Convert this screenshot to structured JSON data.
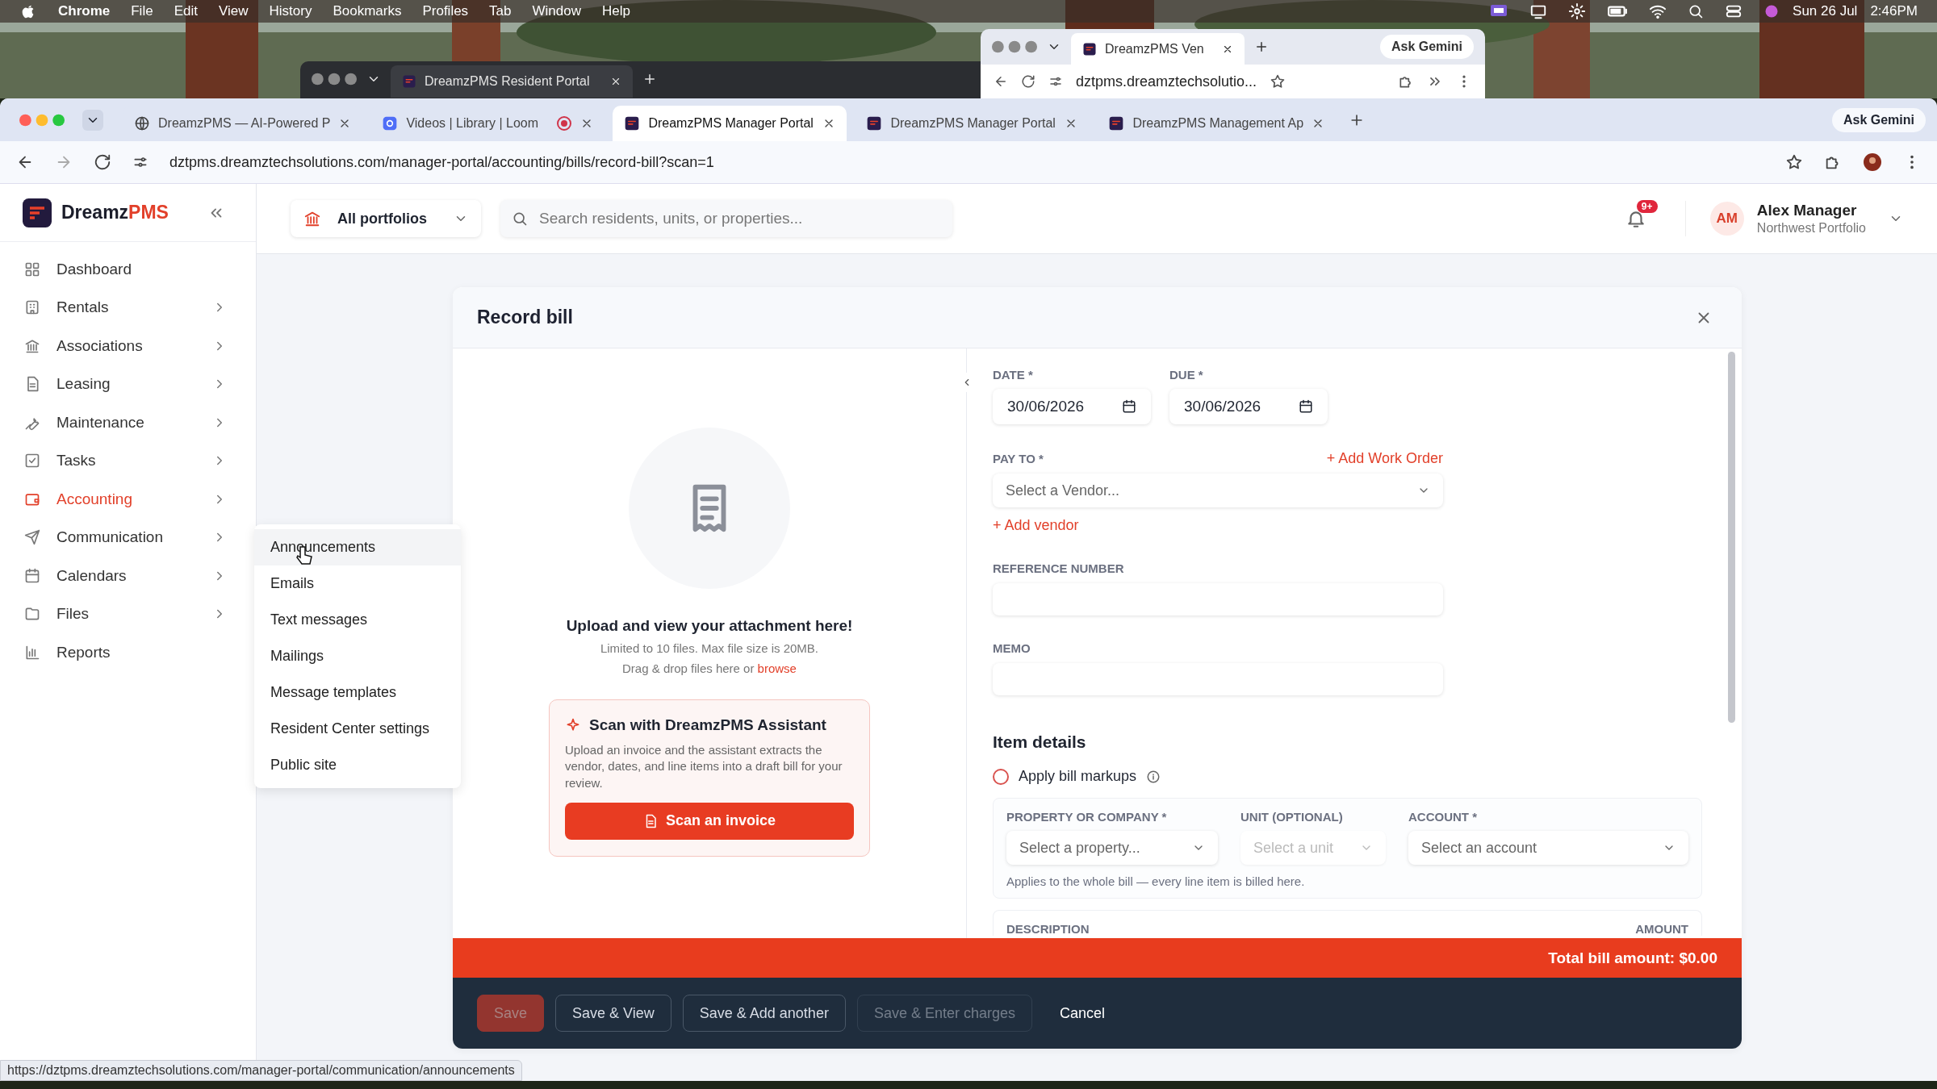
{
  "menubar": {
    "app": "Chrome",
    "menus": [
      "File",
      "Edit",
      "View",
      "History",
      "Bookmarks",
      "Profiles",
      "Tab",
      "Window",
      "Help"
    ],
    "date": "Sun 26 Jul",
    "time": "2:46PM"
  },
  "back_windows": [
    {
      "kind": "dark",
      "tab": "DreamzPMS Resident Portal"
    },
    {
      "kind": "light",
      "tab": "DreamzPMS Ven",
      "ask": "Ask Gemini",
      "url": "dztpms.dreamztechsolutio..."
    }
  ],
  "browser": {
    "tabs": [
      {
        "title": "DreamzPMS — AI-Powered P",
        "recording": false,
        "selected": false
      },
      {
        "title": "Videos | Library | Loom",
        "recording": true,
        "selected": false
      },
      {
        "title": "DreamzPMS Manager Portal",
        "recording": false,
        "selected": true
      },
      {
        "title": "DreamzPMS Manager Portal",
        "recording": false,
        "selected": false
      },
      {
        "title": "DreamzPMS Management Ap",
        "recording": false,
        "selected": false
      }
    ],
    "ask": "Ask Gemini",
    "url": "dztpms.dreamztechsolutions.com/manager-portal/accounting/bills/record-bill?scan=1"
  },
  "sidebar": {
    "brand": {
      "name": "Dreamz",
      "accent": "PMS"
    },
    "items": [
      {
        "label": "Dashboard",
        "expandable": false,
        "selected": false
      },
      {
        "label": "Rentals",
        "expandable": true,
        "selected": false
      },
      {
        "label": "Associations",
        "expandable": true,
        "selected": false
      },
      {
        "label": "Leasing",
        "expandable": true,
        "selected": false
      },
      {
        "label": "Maintenance",
        "expandable": true,
        "selected": false
      },
      {
        "label": "Tasks",
        "expandable": true,
        "selected": false
      },
      {
        "label": "Accounting",
        "expandable": true,
        "selected": true
      },
      {
        "label": "Communication",
        "expandable": true,
        "selected": false
      },
      {
        "label": "Calendars",
        "expandable": true,
        "selected": false
      },
      {
        "label": "Files",
        "expandable": true,
        "selected": false
      },
      {
        "label": "Reports",
        "expandable": false,
        "selected": false
      }
    ]
  },
  "header": {
    "portfolio": "All portfolios",
    "search": {
      "placeholder": "Search residents, units, or properties..."
    },
    "badge": "9+",
    "user": {
      "initials": "AM",
      "name": "Alex Manager",
      "subtitle": "Northwest Portfolio"
    }
  },
  "submenu": {
    "items": [
      {
        "label": "Announcements",
        "hovered": true
      },
      {
        "label": "Emails",
        "hovered": false
      },
      {
        "label": "Text messages",
        "hovered": false
      },
      {
        "label": "Mailings",
        "hovered": false
      },
      {
        "label": "Message templates",
        "hovered": false
      },
      {
        "label": "Resident Center settings",
        "hovered": false
      },
      {
        "label": "Public site",
        "hovered": false
      }
    ]
  },
  "modal": {
    "title": "Record bill",
    "upload": {
      "title": "Upload and view your attachment here!",
      "limits": "Limited to 10 files. Max file size is 20MB.",
      "drop_prompt": "Drag & drop files here or",
      "browse": "browse"
    },
    "scan": {
      "title": "Scan with DreamzPMS Assistant",
      "text": "Upload an invoice and the assistant extracts the vendor, dates, and line items into a draft bill for your review.",
      "button": "Scan an invoice"
    },
    "form": {
      "date": {
        "label": "DATE *",
        "value": "30/06/2026"
      },
      "due": {
        "label": "DUE *",
        "value": "30/06/2026"
      },
      "pay_to": {
        "label": "PAY TO *",
        "link": "+ Add Work Order",
        "placeholder": "Select a Vendor...",
        "add_link": "+ Add vendor"
      },
      "reference": {
        "label": "REFERENCE NUMBER"
      },
      "memo": {
        "label": "MEMO"
      },
      "item_details": {
        "heading": "Item details",
        "markups": {
          "label": "Apply bill markups",
          "checked": false
        },
        "fields": [
          {
            "label": "PROPERTY OR COMPANY *",
            "placeholder": "Select a property...",
            "disabled": false
          },
          {
            "label": "UNIT (OPTIONAL)",
            "placeholder": "Select a unit",
            "disabled": true
          },
          {
            "label": "ACCOUNT *",
            "placeholder": "Select an account",
            "disabled": false
          }
        ],
        "hint": "Applies to the whole bill — every line item is billed here.",
        "columns": [
          "DESCRIPTION",
          "AMOUNT"
        ]
      }
    },
    "total": "Total bill amount: $0.00",
    "buttons": [
      {
        "label": "Save",
        "kind": "primary",
        "disabled": true
      },
      {
        "label": "Save & View",
        "kind": "outline",
        "disabled": false
      },
      {
        "label": "Save & Add another",
        "kind": "outline",
        "disabled": false
      },
      {
        "label": "Save & Enter charges",
        "kind": "outline",
        "disabled": true
      },
      {
        "label": "Cancel",
        "kind": "text",
        "disabled": false
      }
    ]
  },
  "status_url": "https://dztpms.dreamztechsolutions.com/manager-portal/communication/announcements"
}
